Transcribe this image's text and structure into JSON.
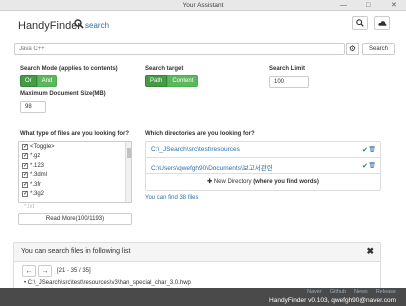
{
  "window": {
    "title": "Your Assistant"
  },
  "brand": {
    "name": "HandyFinder",
    "search_label": "search"
  },
  "search": {
    "placeholder": "Java C++",
    "button_label": "Search"
  },
  "mode": {
    "label": "Search Mode (applies to contents)",
    "options": [
      "Or",
      "And"
    ],
    "selected": "Or"
  },
  "target": {
    "label": "Search target",
    "options": [
      "Path",
      "Content"
    ],
    "selected": "Path"
  },
  "limit": {
    "label": "Search Limit",
    "value": "100"
  },
  "maxsize": {
    "label": "Maximum Document Size(MB)",
    "value": "98"
  },
  "files": {
    "label": "What type of files are you looking for?",
    "items": [
      "<Toggle>",
      "*.gz",
      "*.123",
      "*.3dml",
      "*.3fr",
      "*.3g2"
    ],
    "faded_item": "*.txt",
    "read_more": "Read More(100/1193)"
  },
  "dirs": {
    "label": "Which directories are you looking for?",
    "items": [
      "C:\\_JSearch\\src\\test\\resources",
      "C:\\Users\\qwefgh90\\Documents\\보고서관련"
    ],
    "new_dir": "New Directory",
    "new_dir_hint": "(where you find words)",
    "found": "You can find 38 files"
  },
  "results": {
    "title": "You can search files in following list",
    "range": "[21 - 35 / 35]",
    "first_item": "C:\\_JSearch\\src\\test\\resources\\v3\\han_special_char_3.0.hwp"
  },
  "footer": {
    "links": [
      "Naver",
      "Github",
      "News",
      "Release"
    ],
    "version": "HandyFinder v0.103",
    "email": "qwefgh90@naver.com"
  }
}
